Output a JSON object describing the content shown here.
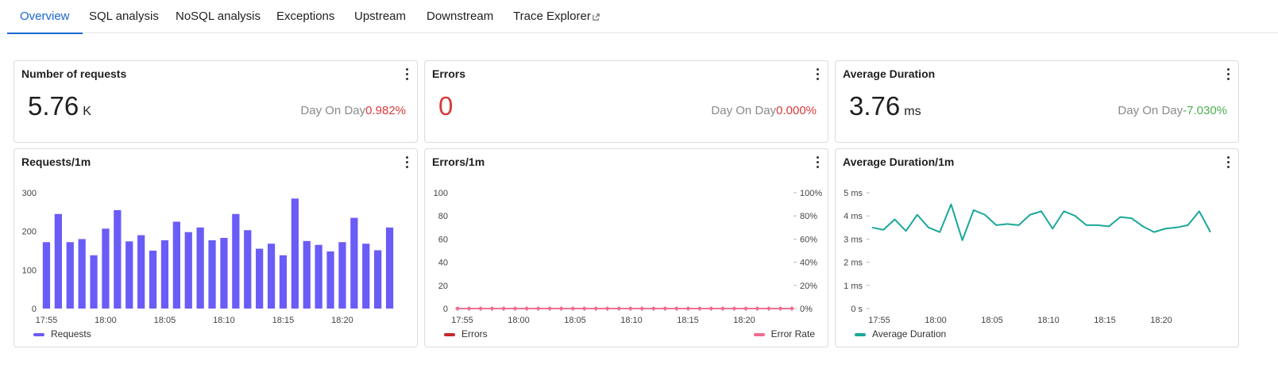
{
  "tabs": [
    {
      "label": "Overview",
      "active": true
    },
    {
      "label": "SQL analysis"
    },
    {
      "label": "NoSQL analysis"
    },
    {
      "label": "Exceptions"
    },
    {
      "label": "Upstream"
    },
    {
      "label": "Downstream"
    },
    {
      "label": "Trace Explorer",
      "external": true
    }
  ],
  "stats": {
    "requests": {
      "title": "Number of requests",
      "value": "5.76",
      "unit": "K",
      "dod_label": "Day On Day",
      "dod_value": "0.982%"
    },
    "errors": {
      "title": "Errors",
      "value": "0",
      "unit": "",
      "dod_label": "Day On Day",
      "dod_value": "0.000%"
    },
    "duration": {
      "title": "Average Duration",
      "value": "3.76",
      "unit": "ms",
      "dod_label": "Day On Day",
      "dod_value": "-7.030%"
    }
  },
  "colors": {
    "accent": "#1967d2",
    "bar": "#6a5cf6",
    "errors": "#c62828",
    "error_rate": "#ef6b8f",
    "line": "#1aa89a",
    "negative": "#d93a3a",
    "positive": "#4caf50"
  },
  "chart_data": [
    {
      "type": "bar",
      "title": "Requests/1m",
      "categories": [
        "17:55",
        "18:00",
        "18:05",
        "18:10",
        "18:15",
        "18:20"
      ],
      "ylim": [
        0,
        300
      ],
      "yticks": [
        0,
        100,
        200,
        300
      ],
      "legend": "bottom-left",
      "series": [
        {
          "name": "Requests",
          "values": [
            172,
            245,
            172,
            180,
            138,
            207,
            255,
            174,
            190,
            150,
            177,
            225,
            198,
            210,
            177,
            183,
            245,
            203,
            155,
            168,
            138,
            285,
            175,
            165,
            148,
            172,
            235,
            168,
            151,
            210
          ]
        }
      ]
    },
    {
      "type": "line",
      "title": "Errors/1m",
      "categories": [
        "17:55",
        "18:00",
        "18:05",
        "18:10",
        "18:15",
        "18:20"
      ],
      "ylim": [
        0,
        100
      ],
      "yticks": [
        0,
        20,
        40,
        60,
        80,
        100
      ],
      "y2ticks": [
        "0%",
        "20%",
        "40%",
        "60%",
        "80%",
        "100%"
      ],
      "legend": "bottom",
      "series": [
        {
          "name": "Errors",
          "values": [
            0,
            0,
            0,
            0,
            0,
            0,
            0,
            0,
            0,
            0,
            0,
            0,
            0,
            0,
            0,
            0,
            0,
            0,
            0,
            0,
            0,
            0,
            0,
            0,
            0,
            0,
            0,
            0,
            0,
            0
          ]
        },
        {
          "name": "Error Rate",
          "values": [
            0,
            0,
            0,
            0,
            0,
            0,
            0,
            0,
            0,
            0,
            0,
            0,
            0,
            0,
            0,
            0,
            0,
            0,
            0,
            0,
            0,
            0,
            0,
            0,
            0,
            0,
            0,
            0,
            0,
            0
          ]
        }
      ]
    },
    {
      "type": "line",
      "title": "Average Duration/1m",
      "categories": [
        "17:55",
        "18:00",
        "18:05",
        "18:10",
        "18:15",
        "18:20"
      ],
      "ylim": [
        0,
        5
      ],
      "yticks": [
        "0 s",
        "1 ms",
        "2 ms",
        "3 ms",
        "4 ms",
        "5 ms"
      ],
      "legend": "bottom-left",
      "series": [
        {
          "name": "Average Duration",
          "values": [
            3.5,
            3.4,
            3.85,
            3.35,
            4.05,
            3.5,
            3.3,
            4.5,
            2.95,
            4.25,
            4.05,
            3.6,
            3.65,
            3.6,
            4.05,
            4.2,
            3.45,
            4.2,
            4.0,
            3.6,
            3.6,
            3.55,
            3.95,
            3.9,
            3.55,
            3.3,
            3.45,
            3.5,
            3.6,
            4.2,
            3.3
          ]
        }
      ]
    }
  ]
}
